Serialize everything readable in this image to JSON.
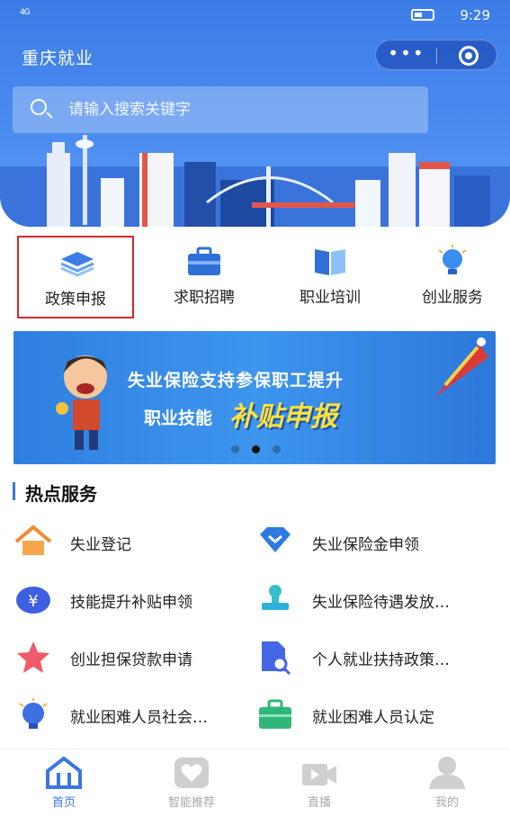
{
  "status_bar": {
    "signal": "4G",
    "time": "9:29"
  },
  "header": {
    "title": "重庆就业",
    "more_icon": "more-dots-icon",
    "close_icon": "target-icon"
  },
  "search": {
    "placeholder": "请输入搜索关键字"
  },
  "quick_actions": [
    {
      "label": "政策申报",
      "icon": "layers-icon",
      "selected": true
    },
    {
      "label": "求职招聘",
      "icon": "briefcase-icon",
      "selected": false
    },
    {
      "label": "职业培训",
      "icon": "book-icon",
      "selected": false
    },
    {
      "label": "创业服务",
      "icon": "lightbulb-icon",
      "selected": false
    }
  ],
  "banner": {
    "line1": "失业保险支持参保职工提升",
    "line2": "职业技能",
    "highlight": "补贴申报",
    "slides": 3,
    "active_slide": 2
  },
  "hot_services": {
    "title": "热点服务",
    "items": [
      {
        "label": "失业登记",
        "icon": "house-icon"
      },
      {
        "label": "失业保险金申领",
        "icon": "diamond-check-icon"
      },
      {
        "label": "技能提升补贴申领",
        "icon": "yen-coin-icon"
      },
      {
        "label": "失业保险待遇发放…",
        "icon": "stamp-icon"
      },
      {
        "label": "创业担保贷款申请",
        "icon": "star-icon"
      },
      {
        "label": "个人就业扶持政策…",
        "icon": "document-search-icon"
      },
      {
        "label": "就业困难人员社会…",
        "icon": "lightbulb-icon"
      },
      {
        "label": "就业困难人员认定",
        "icon": "briefcase-icon"
      }
    ]
  },
  "tab_bar": [
    {
      "label": "首页",
      "icon": "home-icon",
      "active": true
    },
    {
      "label": "智能推荐",
      "icon": "heart-icon",
      "active": false
    },
    {
      "label": "直播",
      "icon": "video-camera-icon",
      "active": false
    },
    {
      "label": "我的",
      "icon": "user-icon",
      "active": false
    }
  ],
  "colors": {
    "primary": "#3b76e0",
    "selected_border": "#d9262c",
    "banner_highlight": "#ffe23a"
  }
}
